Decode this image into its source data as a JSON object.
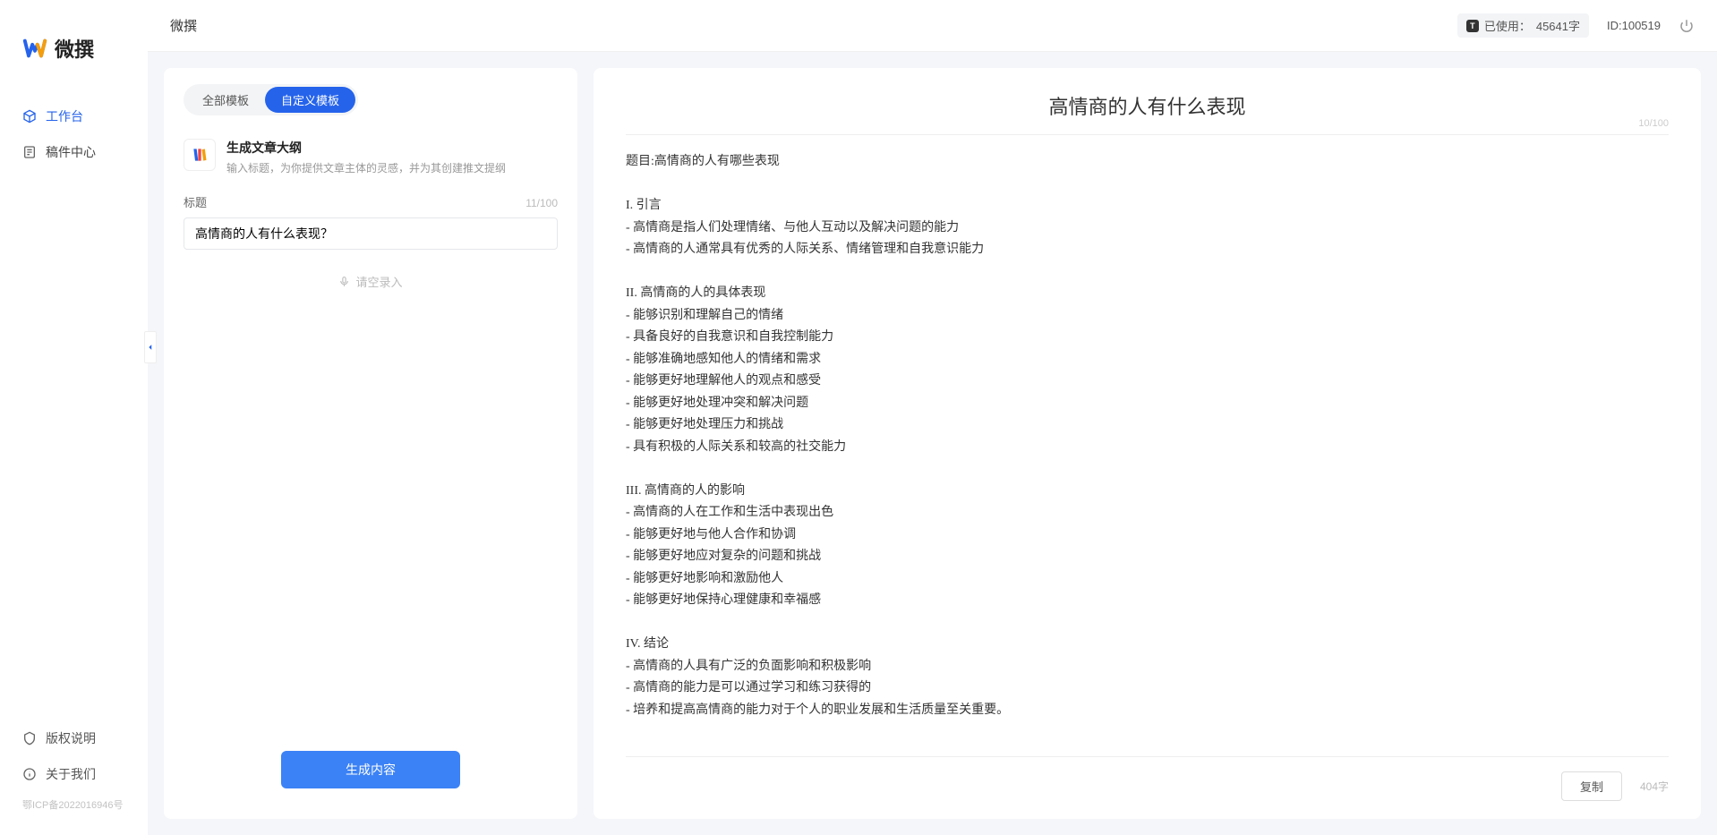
{
  "app": {
    "name": "微撰"
  },
  "topbar": {
    "usage_label": "已使用：",
    "usage_value": "45641字",
    "id_label": "ID:100519"
  },
  "sidebar": {
    "items": [
      {
        "label": "工作台",
        "active": true
      },
      {
        "label": "稿件中心",
        "active": false
      }
    ],
    "bottom": [
      {
        "label": "版权说明"
      },
      {
        "label": "关于我们"
      }
    ],
    "icp": "鄂ICP备2022016946号"
  },
  "left": {
    "tabs": [
      {
        "label": "全部模板",
        "active": false
      },
      {
        "label": "自定义模板",
        "active": true
      }
    ],
    "template": {
      "title": "生成文章大纲",
      "desc": "输入标题，为你提供文章主体的灵感，并为其创建推文提纲"
    },
    "form": {
      "title_label": "标题",
      "title_value": "高情商的人有什么表现？",
      "title_count": "11/100",
      "voice_hint": "请空录入"
    },
    "generate_btn": "生成内容"
  },
  "output": {
    "title": "高情商的人有什么表现",
    "top_count": "10/100",
    "body": "题目:高情商的人有哪些表现\n\nI. 引言\n- 高情商是指人们处理情绪、与他人互动以及解决问题的能力\n- 高情商的人通常具有优秀的人际关系、情绪管理和自我意识能力\n\nII. 高情商的人的具体表现\n- 能够识别和理解自己的情绪\n- 具备良好的自我意识和自我控制能力\n- 能够准确地感知他人的情绪和需求\n- 能够更好地理解他人的观点和感受\n- 能够更好地处理冲突和解决问题\n- 能够更好地处理压力和挑战\n- 具有积极的人际关系和较高的社交能力\n\nIII. 高情商的人的影响\n- 高情商的人在工作和生活中表现出色\n- 能够更好地与他人合作和协调\n- 能够更好地应对复杂的问题和挑战\n- 能够更好地影响和激励他人\n- 能够更好地保持心理健康和幸福感\n\nIV. 结论\n- 高情商的人具有广泛的负面影响和积极影响\n- 高情商的能力是可以通过学习和练习获得的\n- 培养和提高高情商的能力对于个人的职业发展和生活质量至关重要。",
    "copy_btn": "复制",
    "word_count": "404字"
  }
}
